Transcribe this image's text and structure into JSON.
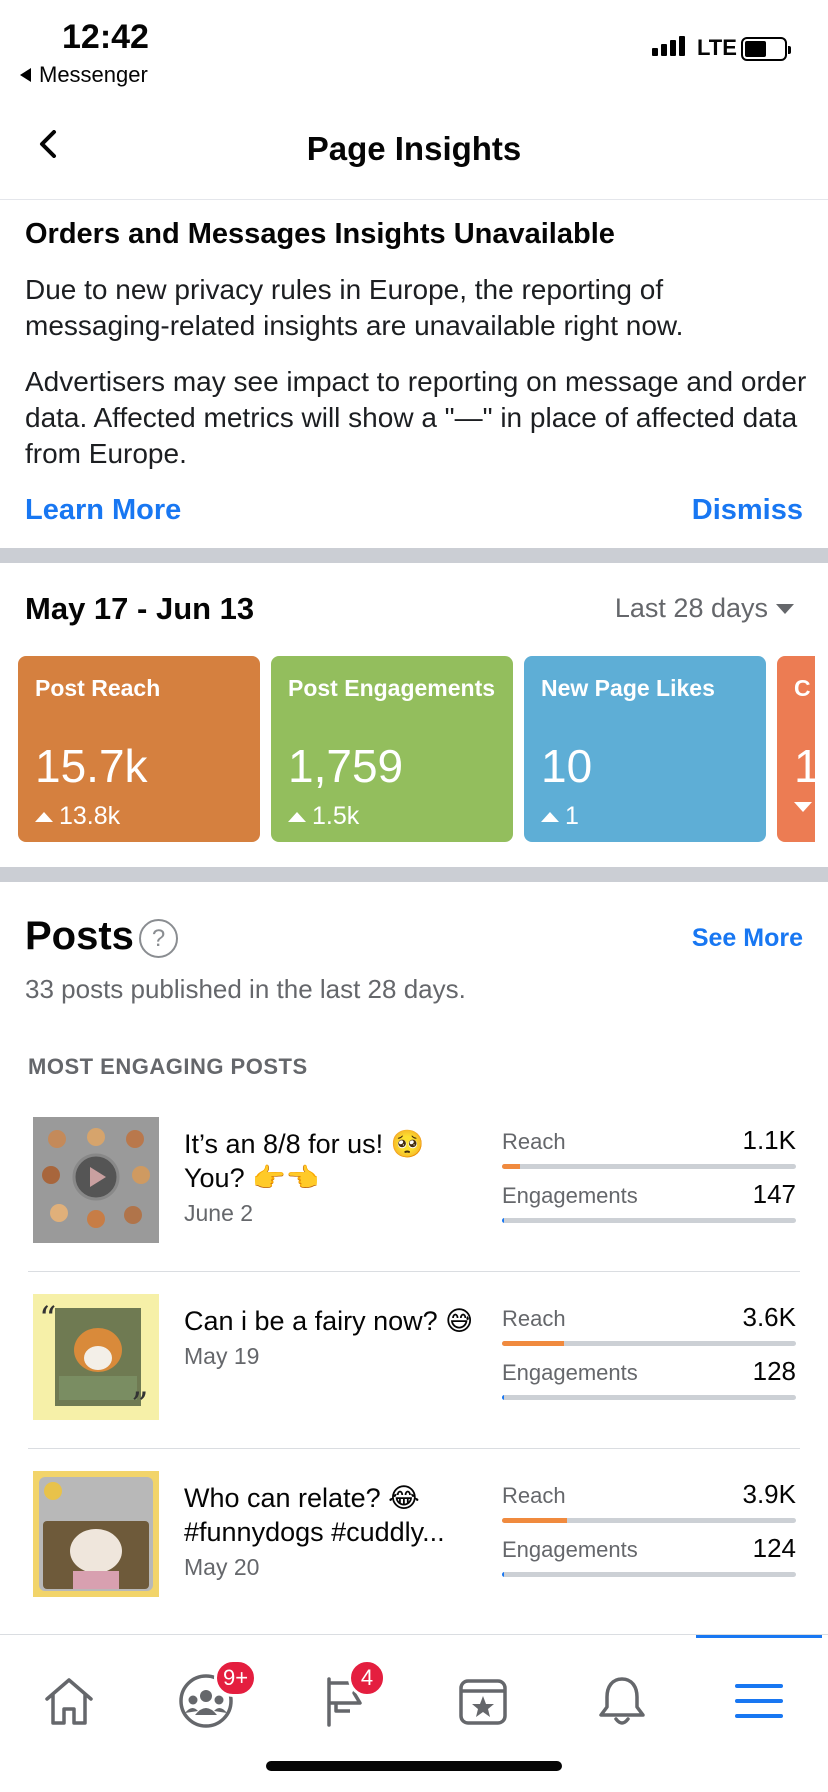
{
  "status_bar": {
    "time": "12:42",
    "back_app": "Messenger",
    "network": "LTE",
    "battery_level": 0.55
  },
  "header": {
    "title": "Page Insights",
    "back_icon": "chevron-left-icon"
  },
  "notice": {
    "title": "Orders and Messages Insights Unavailable",
    "p1": "Due to new privacy rules in Europe, the reporting of messaging-related insights are unavailable right now.",
    "p2": "Advertisers may see impact to reporting on message and order data. Affected metrics will show a \"—\" in place of affected data from Europe.",
    "learn_more": "Learn More",
    "dismiss": "Dismiss"
  },
  "metrics": {
    "date_range": "May 17 - Jun 13",
    "period": "Last 28 days",
    "cards": [
      {
        "label": "Post Reach",
        "value": "15.7k",
        "change": "13.8k",
        "color": "#d5803f"
      },
      {
        "label": "Post Engagements",
        "value": "1,759",
        "change": "1.5k",
        "color": "#93be5d"
      },
      {
        "label": "New Page Likes",
        "value": "10",
        "change": "1",
        "color": "#5eaed6"
      },
      {
        "label": "C",
        "value": "1",
        "change": "",
        "color": "#ec7c53"
      }
    ]
  },
  "posts": {
    "title": "Posts",
    "see_more": "See More",
    "subtitle": "33 posts published in the last 28 days.",
    "section_header": "MOST ENGAGING POSTS",
    "items": [
      {
        "caption": "It’s an 8/8 for us! 🥺 You? 👉👈",
        "date": "June 2",
        "reach_label": "Reach",
        "reach": "1.1K",
        "reach_fill": 0.06,
        "engagements_label": "Engagements",
        "engagements": "147",
        "eng_fill": 0.005
      },
      {
        "caption": "Can i be a fairy now? 😅",
        "date": "May 19",
        "reach_label": "Reach",
        "reach": "3.6K",
        "reach_fill": 0.21,
        "engagements_label": "Engagements",
        "engagements": "128",
        "eng_fill": 0.005
      },
      {
        "caption": "Who can relate? 😂 #funnydogs #cuddly...",
        "date": "May 20",
        "reach_label": "Reach",
        "reach": "3.9K",
        "reach_fill": 0.22,
        "engagements_label": "Engagements",
        "engagements": "124",
        "eng_fill": 0.005
      }
    ]
  },
  "tabbar": {
    "tabs": [
      "home-icon",
      "groups-icon",
      "pages-icon",
      "marketplace-icon",
      "notifications-icon",
      "menu-icon"
    ],
    "groups_badge": "9+",
    "pages_badge": "4",
    "active_color": "#1877f2"
  }
}
